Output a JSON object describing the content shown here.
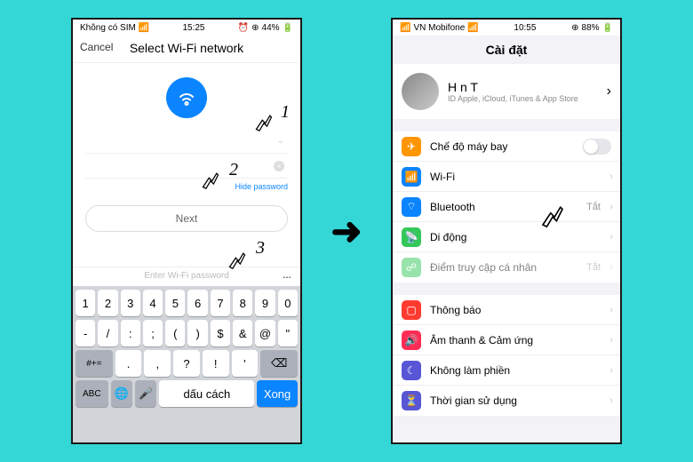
{
  "left": {
    "status": {
      "carrier": "Không có SIM",
      "time": "15:25",
      "battery": "44%"
    },
    "header": {
      "cancel": "Cancel",
      "title": "Select Wi-Fi network"
    },
    "network_field": "",
    "password_field": "",
    "hide_password": "Hide password",
    "next": "Next",
    "kb_hint": "Enter Wi-Fi password",
    "keyboard": {
      "row1": [
        "1",
        "2",
        "3",
        "4",
        "5",
        "6",
        "7",
        "8",
        "9",
        "0"
      ],
      "row2": [
        "-",
        "/",
        ":",
        ";",
        "(",
        ")",
        "$",
        "&",
        "@",
        "\""
      ],
      "row3_shift": "#+=",
      "row3": [
        ".",
        ",",
        "?",
        "!",
        "'"
      ],
      "row3_del": "⌫",
      "abc": "ABC",
      "globe": "🌐",
      "mic": "🎤",
      "space": "dấu cách",
      "done": "Xong"
    }
  },
  "right": {
    "status": {
      "carrier": "VN Mobifone",
      "time": "10:55",
      "battery": "88%"
    },
    "title": "Cài đặt",
    "profile": {
      "name": "H      n T",
      "sub": "ID Apple, iCloud, iTunes & App Store"
    },
    "rows": {
      "airplane": "Chế độ máy bay",
      "wifi": "Wi-Fi",
      "bt": "Bluetooth",
      "bt_val": "Tắt",
      "cell": "Di động",
      "hotspot": "Điểm truy cập cá nhân",
      "hotspot_val": "Tắt",
      "notif": "Thông báo",
      "sound": "Âm thanh & Cảm ứng",
      "dnd": "Không làm phiền",
      "screentime": "Thời gian sử dụng"
    }
  },
  "tags": {
    "one": "1",
    "two": "2",
    "three": "3"
  },
  "colors": {
    "orange": "#ff9500",
    "blue": "#0a84ff",
    "green": "#34c759",
    "red": "#ff3b30",
    "pink": "#ff2d55",
    "purple": "#5856d6",
    "gray": "#8e8e93",
    "teal": "#30b0c7"
  }
}
